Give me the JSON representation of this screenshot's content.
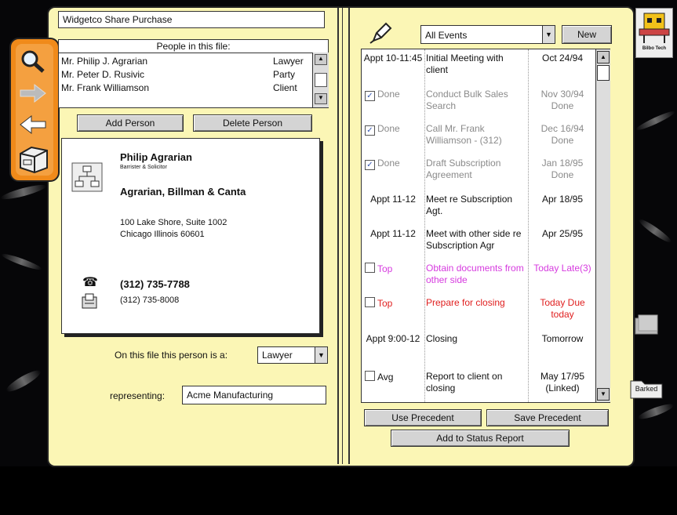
{
  "file": {
    "title": "Widgetco Share Purchase"
  },
  "people": {
    "header": "People in this file:",
    "rows": [
      {
        "name": "Mr. Philip J. Agrarian",
        "role": "Lawyer"
      },
      {
        "name": "Mr. Peter D. Rusivic",
        "role": "Party"
      },
      {
        "name": "Mr. Frank Williamson",
        "role": "Client"
      }
    ],
    "add_label": "Add Person",
    "delete_label": "Delete Person"
  },
  "card": {
    "name": "Philip Agrarian",
    "title": "Barrister & Solicitor",
    "firm": "Agrarian, Billman & Canta",
    "address1": "100 Lake Shore, Suite 1002",
    "address2": "Chicago Illinois 60601",
    "phone": "(312) 735-7788",
    "fax": "(312) 735-8008"
  },
  "role_line": {
    "label": "On this file this person is a:",
    "value": "Lawyer"
  },
  "representing": {
    "label": "representing:",
    "value": "Acme Manufacturing"
  },
  "events": {
    "filter": "All Events",
    "new_label": "New",
    "rows": [
      {
        "c1": "Appt 10-11:45",
        "c2": "Initial Meeting with client",
        "c3": "Oct 24/94",
        "check": false,
        "color": "#111"
      },
      {
        "c1": "Done",
        "c2": "Conduct Bulk Sales Search",
        "c3": "Nov 30/94 Done",
        "check": true,
        "color": "#8a8a8a"
      },
      {
        "c1": "Done",
        "c2": "Call Mr. Frank Williamson - (312)",
        "c3": "Dec 16/94 Done",
        "check": true,
        "color": "#8a8a8a"
      },
      {
        "c1": "Done",
        "c2": "Draft Subscription Agreement",
        "c3": "Jan 18/95 Done",
        "check": true,
        "color": "#8a8a8a"
      },
      {
        "c1": "Appt 11-12",
        "c2": "Meet re Subscription Agt.",
        "c3": "Apr 18/95",
        "check": false,
        "color": "#111"
      },
      {
        "c1": "Appt 11-12",
        "c2": "Meet with other side re Subscription Agr",
        "c3": "Apr 25/95",
        "check": false,
        "color": "#111"
      },
      {
        "c1": "Top",
        "c2": "Obtain documents from other side",
        "c3": "Today Late(3)",
        "check": "box",
        "color": "#d63adf"
      },
      {
        "c1": "Top",
        "c2": "Prepare for closing",
        "c3": "Today Due today",
        "check": "box",
        "color": "#e02020"
      },
      {
        "c1": "Appt 9:00-12",
        "c2": "Closing",
        "c3": "Tomorrow",
        "check": false,
        "color": "#111"
      },
      {
        "c1": "Avg",
        "c2": "Report to client on closing",
        "c3": "May 17/95 (Linked)",
        "check": "box",
        "color": "#111"
      }
    ],
    "use_precedent": "Use Precedent",
    "save_precedent": "Save Precedent",
    "add_status": "Add to Status Report"
  },
  "sidebar": {
    "icon_label": "Bilbo Tech",
    "archive_label": "Barked"
  },
  "colors": {
    "binder": "#fbf6b5",
    "nav": "#f08a1a",
    "magenta": "#d63adf",
    "red": "#e02020",
    "check_blue": "#3556b0"
  }
}
